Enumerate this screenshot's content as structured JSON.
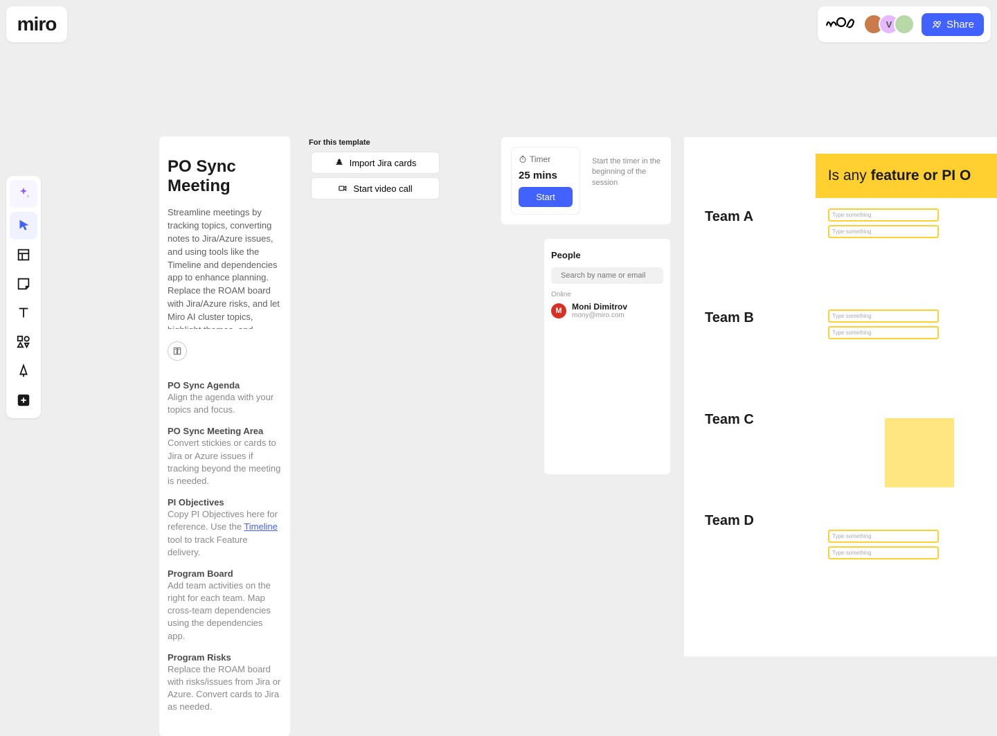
{
  "app": {
    "logo": "miro"
  },
  "header": {
    "share_label": "Share",
    "avatars": [
      {
        "bg": "#c97b4a"
      },
      {
        "bg": "#e6b8ff",
        "letter": "V",
        "fg": "#555"
      },
      {
        "bg": "#b8d8a8"
      }
    ]
  },
  "description": {
    "title": "PO Sync Meeting",
    "body": "Streamline meetings by tracking topics, converting notes to Jira/Azure issues, and using tools like the Timeline and dependencies app to enhance planning. Replace the ROAM board with Jira/Azure risks, and let Miro AI cluster topics, highlight themes, and generate summaries."
  },
  "template": {
    "section_label": "For this template",
    "import_btn": "Import Jira cards",
    "videocall_btn": "Start video call"
  },
  "agenda": {
    "sections": [
      {
        "title": "PO Sync Agenda",
        "body": "Align the agenda with your topics and focus."
      },
      {
        "title": "PO Sync Meeting Area",
        "body": "Convert stickies or cards to Jira or Azure issues if tracking beyond the meeting is needed."
      },
      {
        "title": "PI Objectives",
        "body_pre": "Copy PI Objectives here for reference. Use the ",
        "link": "Timeline",
        "body_post": " tool to track Feature delivery."
      },
      {
        "title": "Program Board",
        "body": "Add team activities on the right for each team. Map cross-team dependencies using the dependencies app."
      },
      {
        "title": "Program Risks",
        "body": "Replace the ROAM board with risks/issues from Jira or Azure. Convert cards to Jira as needed."
      }
    ]
  },
  "timer": {
    "label": "Timer",
    "duration": "25 mins",
    "start_label": "Start",
    "hint": "Start the timer in the beginning of the session"
  },
  "people": {
    "title": "People",
    "search_placeholder": "Search by name or email",
    "online_label": "Online",
    "users": [
      {
        "initial": "M",
        "name": "Moni Dimitrov",
        "email": "mony@miro.com"
      }
    ]
  },
  "teams_section": {
    "question_pre": "Is any ",
    "question_bold": "feature or PI O",
    "teams": [
      "Team A",
      "Team B",
      "Team C",
      "Team D"
    ],
    "placeholder": "Type something"
  }
}
